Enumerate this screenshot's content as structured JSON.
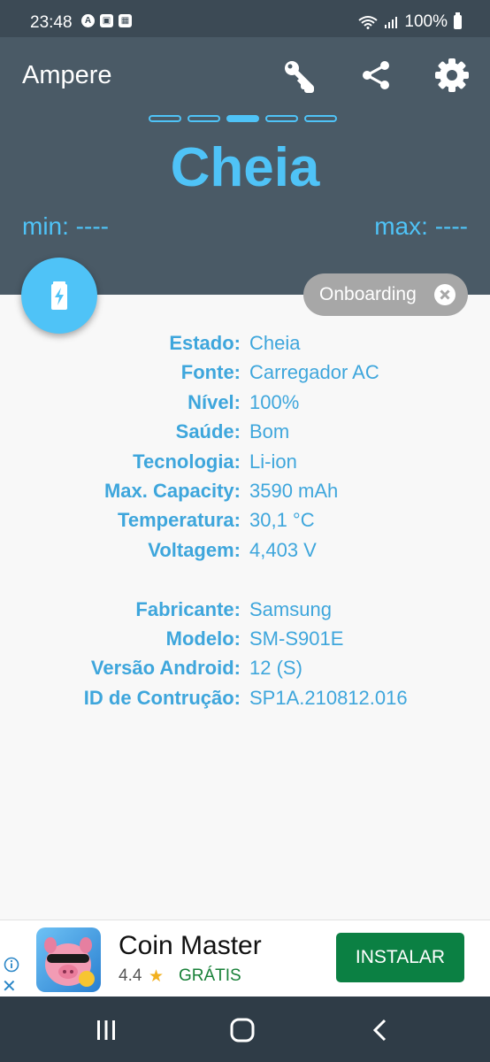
{
  "status_bar": {
    "time": "23:48",
    "battery": "100%",
    "notification_icons": [
      "a-icon",
      "image-icon",
      "qr-icon"
    ]
  },
  "header": {
    "title": "Ampere",
    "icons": [
      "key-icon",
      "share-icon",
      "gear-icon"
    ],
    "state": "Cheia",
    "min": "min: ----",
    "max": "max: ----",
    "pages": 5,
    "active_page": 3,
    "accent": "#4fc3f7"
  },
  "chip": {
    "label": "Onboarding"
  },
  "info": {
    "rows": [
      {
        "label": "Estado:",
        "value": "Cheia"
      },
      {
        "label": "Fonte:",
        "value": "Carregador AC"
      },
      {
        "label": "Nível:",
        "value": "100%"
      },
      {
        "label": "Saúde:",
        "value": "Bom"
      },
      {
        "label": "Tecnologia:",
        "value": "Li-ion"
      },
      {
        "label": "Max. Capacity:",
        "value": "3590 mAh"
      },
      {
        "label": "Temperatura:",
        "value": "30,1 °C"
      },
      {
        "label": "Voltagem:",
        "value": "4,403 V"
      }
    ],
    "device_rows": [
      {
        "label": "Fabricante:",
        "value": "Samsung"
      },
      {
        "label": "Modelo:",
        "value": "SM-S901E"
      },
      {
        "label": "Versão Android:",
        "value": "12 (S)"
      },
      {
        "label": "ID de Contrução:",
        "value": "SP1A.210812.016"
      }
    ]
  },
  "ad": {
    "title": "Coin Master",
    "rating": "4.4",
    "price": "GRÁTIS",
    "install": "INSTALAR"
  }
}
